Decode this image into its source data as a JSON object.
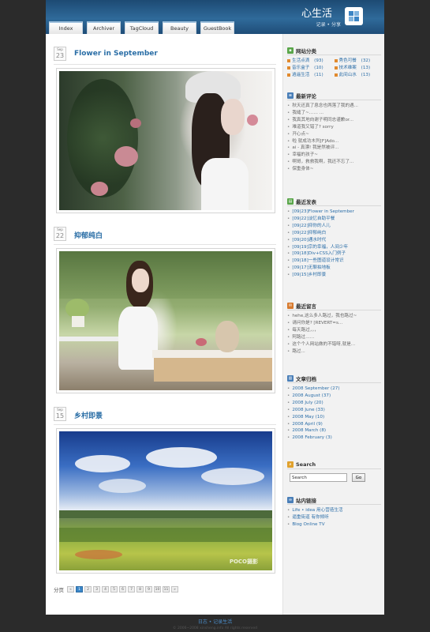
{
  "header": {
    "site_title": "心生活",
    "site_subtitle": "记录 • 分享",
    "nav": [
      "Index",
      "Archiver",
      "TagCloud",
      "Beauty",
      "GuestBook"
    ]
  },
  "posts": [
    {
      "month": "Sep",
      "day": "23",
      "title": "Flower in September",
      "photo": "girl-in-white-hat-with-flowers"
    },
    {
      "month": "Sep",
      "day": "22",
      "title": "抑郁纯白",
      "photo": "girl-at-white-table-with-teddy-bear"
    },
    {
      "month": "Sep",
      "day": "15",
      "title": "乡村即景",
      "photo": "countryside-fields-blue-sky",
      "watermark": "POCO摄影"
    }
  ],
  "pagination": {
    "label": "分页",
    "pages": [
      "«",
      "1",
      "2",
      "3",
      "4",
      "5",
      "6",
      "7",
      "8",
      "9",
      "10",
      "11",
      "»"
    ],
    "current": "1"
  },
  "sidebar": {
    "categories": {
      "title": "网站分类",
      "items": [
        {
          "label": "生活点滴",
          "count": "(93)"
        },
        {
          "label": "秀色可餐",
          "count": "(32)"
        },
        {
          "label": "音乐盒子",
          "count": "(10)"
        },
        {
          "label": "技术维案",
          "count": "(13)"
        },
        {
          "label": "逍遥生活",
          "count": "(11)"
        },
        {
          "label": "此间山水",
          "count": "(13)"
        }
      ]
    },
    "comments": {
      "title": "最新评论",
      "items": [
        "秋天还真了息念也两落了我的遇...",
        "我缝了~……  ...",
        "我真其地向谢子明同志谨歉or...",
        "难道我又错了? sorry",
        "开心点~",
        "啦 就成功木列[F]Ado...",
        "ai - 真漂! 我是然被评...",
        "幸福的孩子~",
        "啊哥，救救我啊，我还不忘了...",
        "保重身体~"
      ]
    },
    "recent_posts": {
      "title": "最近发表",
      "items": [
        "[09|23]Flower in September",
        "[09|22]淡忆自助平餐",
        "[09|22]抑你的人儿",
        "[09|22]抑郁纯白",
        "[09|20]通水时代",
        "[09|19]宗的幸福，人间少年",
        "[09|18]Div+CSS入门例子",
        "[09|18]一些图道设计常识",
        "[09|17]无聊拍地板",
        "[09|15]乡村即景"
      ]
    },
    "guestbook": {
      "title": "最近留言",
      "items": [
        "hehe,这么多人路过，我也路过~",
        "请问你是? [REVERT=s...",
        "每天路过，，，",
        "阿路过……",
        "这个个人网站做的不错呀,就是...",
        "路过..."
      ]
    },
    "archive": {
      "title": "文章归档",
      "items": [
        "2008 September (27)",
        "2008 August (37)",
        "2008 July (20)",
        "2008 June (33)",
        "2008 May (10)",
        "2008 April (9)",
        "2008 March (8)",
        "2008 February (3)"
      ]
    },
    "search": {
      "title": "Search",
      "input_value": "Search",
      "button_label": "Go"
    },
    "links": {
      "title": "站内链接",
      "items": [
        "Life • idea 用心营造生活",
        "逼重街道 有你倾听",
        "Blog Online TV"
      ]
    }
  },
  "footer": {
    "links": "日志 • 记录生活",
    "copyright": "© 2006~2008 xinsheng.info All rights reserved"
  },
  "colors": {
    "header": "#2f6a9a",
    "link": "#2b6ea8",
    "accent_orange": "#e18a2e",
    "active_page": "#3a86c8"
  }
}
